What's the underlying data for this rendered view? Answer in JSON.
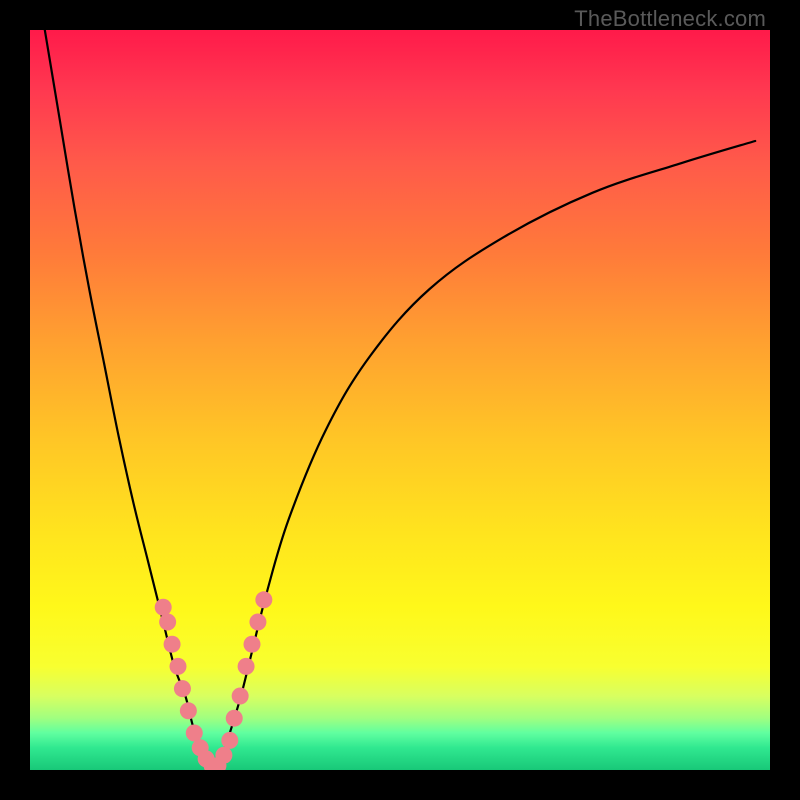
{
  "watermark": "TheBottleneck.com",
  "colors": {
    "frame": "#000000",
    "marker": "#ef7f8a",
    "curve": "#000000",
    "gradient_stops": [
      "#ff1a4a",
      "#ff3850",
      "#ff5a4a",
      "#ff7a3a",
      "#ffa030",
      "#ffc526",
      "#ffe41e",
      "#fff81a",
      "#f8ff30",
      "#d8ff60",
      "#a0ff80",
      "#60ffa0",
      "#30e890",
      "#18c878"
    ]
  },
  "chart_data": {
    "type": "line",
    "title": "",
    "xlabel": "",
    "ylabel": "",
    "xlim": [
      0,
      100
    ],
    "ylim": [
      0,
      100
    ],
    "grid": false,
    "legend": false,
    "series": [
      {
        "name": "left-curve",
        "x": [
          2,
          4,
          6,
          8,
          10,
          12,
          14,
          16,
          18,
          19.5,
          21,
          22,
          23,
          24,
          25
        ],
        "y": [
          100,
          88,
          76,
          65,
          55,
          45,
          36,
          28,
          20,
          14,
          10,
          6,
          3,
          1,
          0
        ]
      },
      {
        "name": "right-curve",
        "x": [
          25,
          26,
          27,
          28.5,
          30,
          32,
          35,
          40,
          46,
          54,
          64,
          76,
          88,
          98
        ],
        "y": [
          0,
          2,
          5,
          10,
          16,
          24,
          34,
          46,
          56,
          65,
          72,
          78,
          82,
          85
        ]
      }
    ],
    "markers": {
      "name": "pink-dots",
      "points": [
        {
          "x": 18.0,
          "y": 22
        },
        {
          "x": 18.6,
          "y": 20
        },
        {
          "x": 19.2,
          "y": 17
        },
        {
          "x": 20.0,
          "y": 14
        },
        {
          "x": 20.6,
          "y": 11
        },
        {
          "x": 21.4,
          "y": 8
        },
        {
          "x": 22.2,
          "y": 5
        },
        {
          "x": 23.0,
          "y": 3
        },
        {
          "x": 23.8,
          "y": 1.5
        },
        {
          "x": 24.6,
          "y": 0.6
        },
        {
          "x": 25.4,
          "y": 0.6
        },
        {
          "x": 26.2,
          "y": 2
        },
        {
          "x": 27.0,
          "y": 4
        },
        {
          "x": 27.6,
          "y": 7
        },
        {
          "x": 28.4,
          "y": 10
        },
        {
          "x": 29.2,
          "y": 14
        },
        {
          "x": 30.0,
          "y": 17
        },
        {
          "x": 30.8,
          "y": 20
        },
        {
          "x": 31.6,
          "y": 23
        }
      ]
    }
  }
}
